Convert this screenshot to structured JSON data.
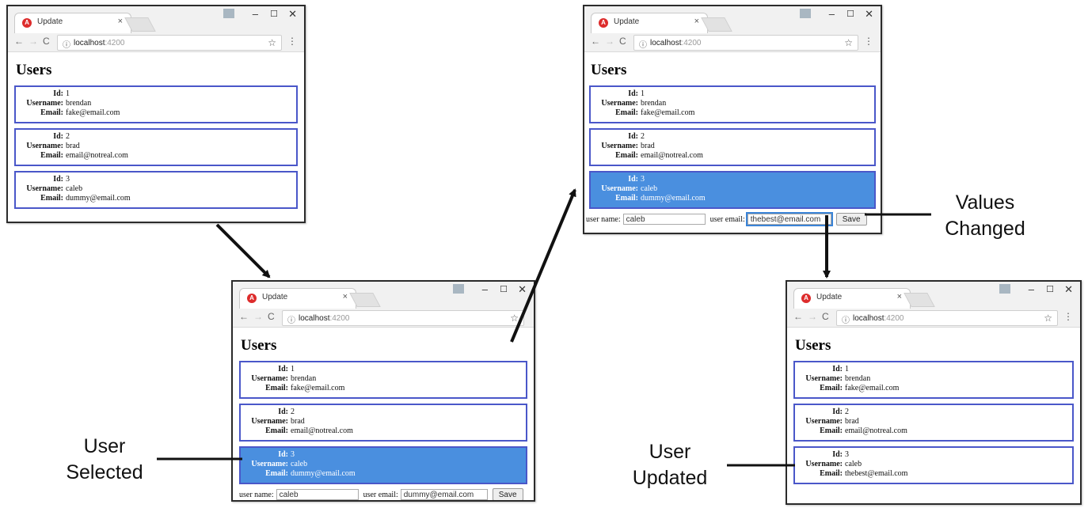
{
  "browser": {
    "tab_title": "Update",
    "tab_close": "×",
    "url_host": "localhost",
    "url_port": ":4200",
    "icons": [
      "angular-favicon",
      "back-arrow",
      "forward-arrow",
      "reload",
      "info",
      "star",
      "kebab-menu",
      "minimize",
      "maximize",
      "close"
    ]
  },
  "page": {
    "title": "Users",
    "id_label": "Id:",
    "username_label": "Username:",
    "email_label": "Email:",
    "user_name_label": "user name:",
    "user_email_label": "user email:",
    "save_label": "Save"
  },
  "screens": [
    {
      "selected_user": null,
      "users": [
        {
          "id": "1",
          "username": "brendan",
          "email": "fake@email.com"
        },
        {
          "id": "2",
          "username": "brad",
          "email": "email@notreal.com"
        },
        {
          "id": "3",
          "username": "caleb",
          "email": "dummy@email.com"
        }
      ],
      "form": null
    },
    {
      "selected_user": 2,
      "users": [
        {
          "id": "1",
          "username": "brendan",
          "email": "fake@email.com"
        },
        {
          "id": "2",
          "username": "brad",
          "email": "email@notreal.com"
        },
        {
          "id": "3",
          "username": "caleb",
          "email": "dummy@email.com"
        }
      ],
      "form": {
        "user_name": "caleb",
        "user_email": "dummy@email.com"
      }
    },
    {
      "selected_user": 2,
      "users": [
        {
          "id": "1",
          "username": "brendan",
          "email": "fake@email.com"
        },
        {
          "id": "2",
          "username": "brad",
          "email": "email@notreal.com"
        },
        {
          "id": "3",
          "username": "caleb",
          "email": "dummy@email.com"
        }
      ],
      "form": {
        "user_name": "caleb",
        "user_email": "thebest@email.com"
      }
    },
    {
      "selected_user": null,
      "users": [
        {
          "id": "1",
          "username": "brendan",
          "email": "fake@email.com"
        },
        {
          "id": "2",
          "username": "brad",
          "email": "email@notreal.com"
        },
        {
          "id": "3",
          "username": "caleb",
          "email": "thebest@email.com"
        }
      ],
      "form": null
    }
  ],
  "callouts": {
    "user_selected": [
      "User",
      "Selected"
    ],
    "values_changed": [
      "Values",
      "Changed"
    ],
    "user_updated": [
      "User",
      "Updated"
    ]
  },
  "colors": {
    "card_border": "#4a57c9",
    "selected_bg": "#4a8fdf",
    "favicon": "#dd2c2c"
  }
}
